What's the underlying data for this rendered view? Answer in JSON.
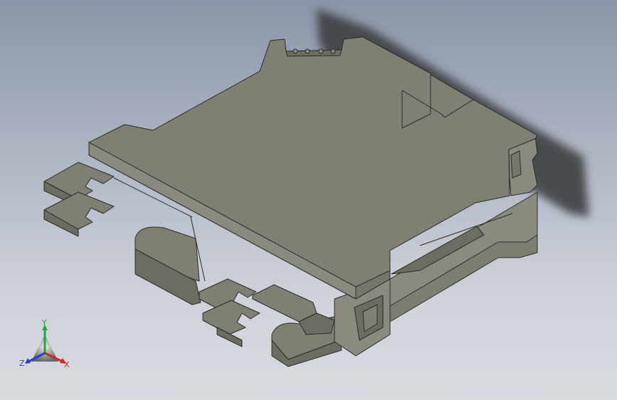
{
  "viewport": {
    "background_top": "#8a95a7",
    "background_bottom": "#d8dbe0",
    "model_face_top": "#7f8073",
    "model_face_side": "#8a8b7e",
    "model_face_dark": "#6c6d62",
    "model_edge": "#2b2c28",
    "shadow": "#3d4143"
  },
  "triad": {
    "x_label": "X",
    "y_label": "Y",
    "z_label": "Z",
    "x_color": "#d22a2a",
    "y_color": "#26a63a",
    "z_color": "#2b3fd0"
  }
}
